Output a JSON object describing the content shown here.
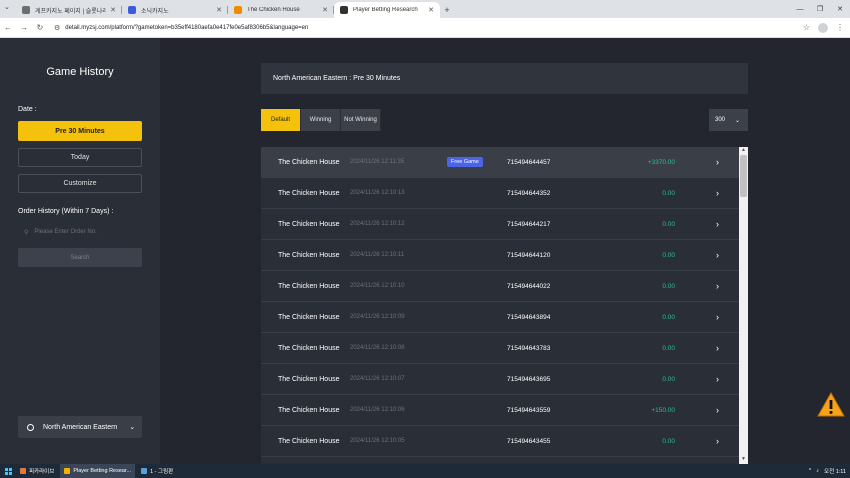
{
  "browser": {
    "tabs": [
      {
        "label": "게프카지노 페이지 | 슬롯나라",
        "favicon_color": "#6d6d6d",
        "active": false
      },
      {
        "label": "소닉카지노",
        "favicon_color": "#3b5bdb",
        "active": false
      },
      {
        "label": "The Chicken House",
        "favicon_color": "#f08c00",
        "active": false
      },
      {
        "label": "Player Betting Research",
        "favicon_color": "#333333",
        "active": true
      }
    ],
    "url": "detail.myzsj.com/platform/?gametoken=b35eff4180aefa0e417fe0e5af8306b5&language=en"
  },
  "sidebar": {
    "title": "Game History",
    "date_label": "Date :",
    "date_buttons": {
      "pre30": "Pre 30 Minutes",
      "today": "Today",
      "customize": "Customize"
    },
    "order_label": "Order History (Within 7 Days) :",
    "order_placeholder": "Please Enter Order No.",
    "search_label": "Search",
    "region": "North American Eastern"
  },
  "main": {
    "header": "North American Eastern : Pre 30 Minutes",
    "filters": {
      "default": "Default",
      "winning": "Winning",
      "not_winning": "Not Winning"
    },
    "page_size": "300",
    "rows": [
      {
        "game": "The Chicken House",
        "time": "2024/11/26 12:11:35",
        "badge": "Free Game",
        "id": "715494644457",
        "amount": "+3370.00",
        "amount_color": "#2dbf95"
      },
      {
        "game": "The Chicken House",
        "time": "2024/11/26 12:10:13",
        "badge": "",
        "id": "715494644352",
        "amount": "0.00",
        "amount_color": "#2dbf95"
      },
      {
        "game": "The Chicken House",
        "time": "2024/11/26 12:10:12",
        "badge": "",
        "id": "715494644217",
        "amount": "0.00",
        "amount_color": "#2dbf95"
      },
      {
        "game": "The Chicken House",
        "time": "2024/11/26 12:10:11",
        "badge": "",
        "id": "715494644120",
        "amount": "0.00",
        "amount_color": "#2dbf95"
      },
      {
        "game": "The Chicken House",
        "time": "2024/11/26 12:10:10",
        "badge": "",
        "id": "715494644022",
        "amount": "0.00",
        "amount_color": "#2dbf95"
      },
      {
        "game": "The Chicken House",
        "time": "2024/11/26 12:10:09",
        "badge": "",
        "id": "715494643894",
        "amount": "0.00",
        "amount_color": "#2dbf95"
      },
      {
        "game": "The Chicken House",
        "time": "2024/11/26 12:10:08",
        "badge": "",
        "id": "715494643783",
        "amount": "0.00",
        "amount_color": "#2dbf95"
      },
      {
        "game": "The Chicken House",
        "time": "2024/11/26 12:10:07",
        "badge": "",
        "id": "715494643695",
        "amount": "0.00",
        "amount_color": "#2dbf95"
      },
      {
        "game": "The Chicken House",
        "time": "2024/11/26 12:10:06",
        "badge": "",
        "id": "715494643559",
        "amount": "+150.00",
        "amount_color": "#2dbf95"
      },
      {
        "game": "The Chicken House",
        "time": "2024/11/26 12:10:05",
        "badge": "",
        "id": "715494643455",
        "amount": "0.00",
        "amount_color": "#2dbf95"
      },
      {
        "game": "The Chicken House",
        "time": "",
        "badge": "",
        "id": "",
        "amount": "",
        "amount_color": "#2dbf95"
      }
    ]
  },
  "taskbar": {
    "items": [
      {
        "label": "피카라이브",
        "active": false,
        "icon_color": "#e07b39"
      },
      {
        "label": "Player Betting Resear...",
        "active": true,
        "icon_color": "#f4b400"
      },
      {
        "label": "1 - 그림판",
        "active": false,
        "icon_color": "#5aa0d8"
      }
    ],
    "clock": "오전 1:11"
  },
  "colors": {
    "accent": "#f4c20d",
    "win": "#2dbf95",
    "badge": "#4b63e6"
  }
}
